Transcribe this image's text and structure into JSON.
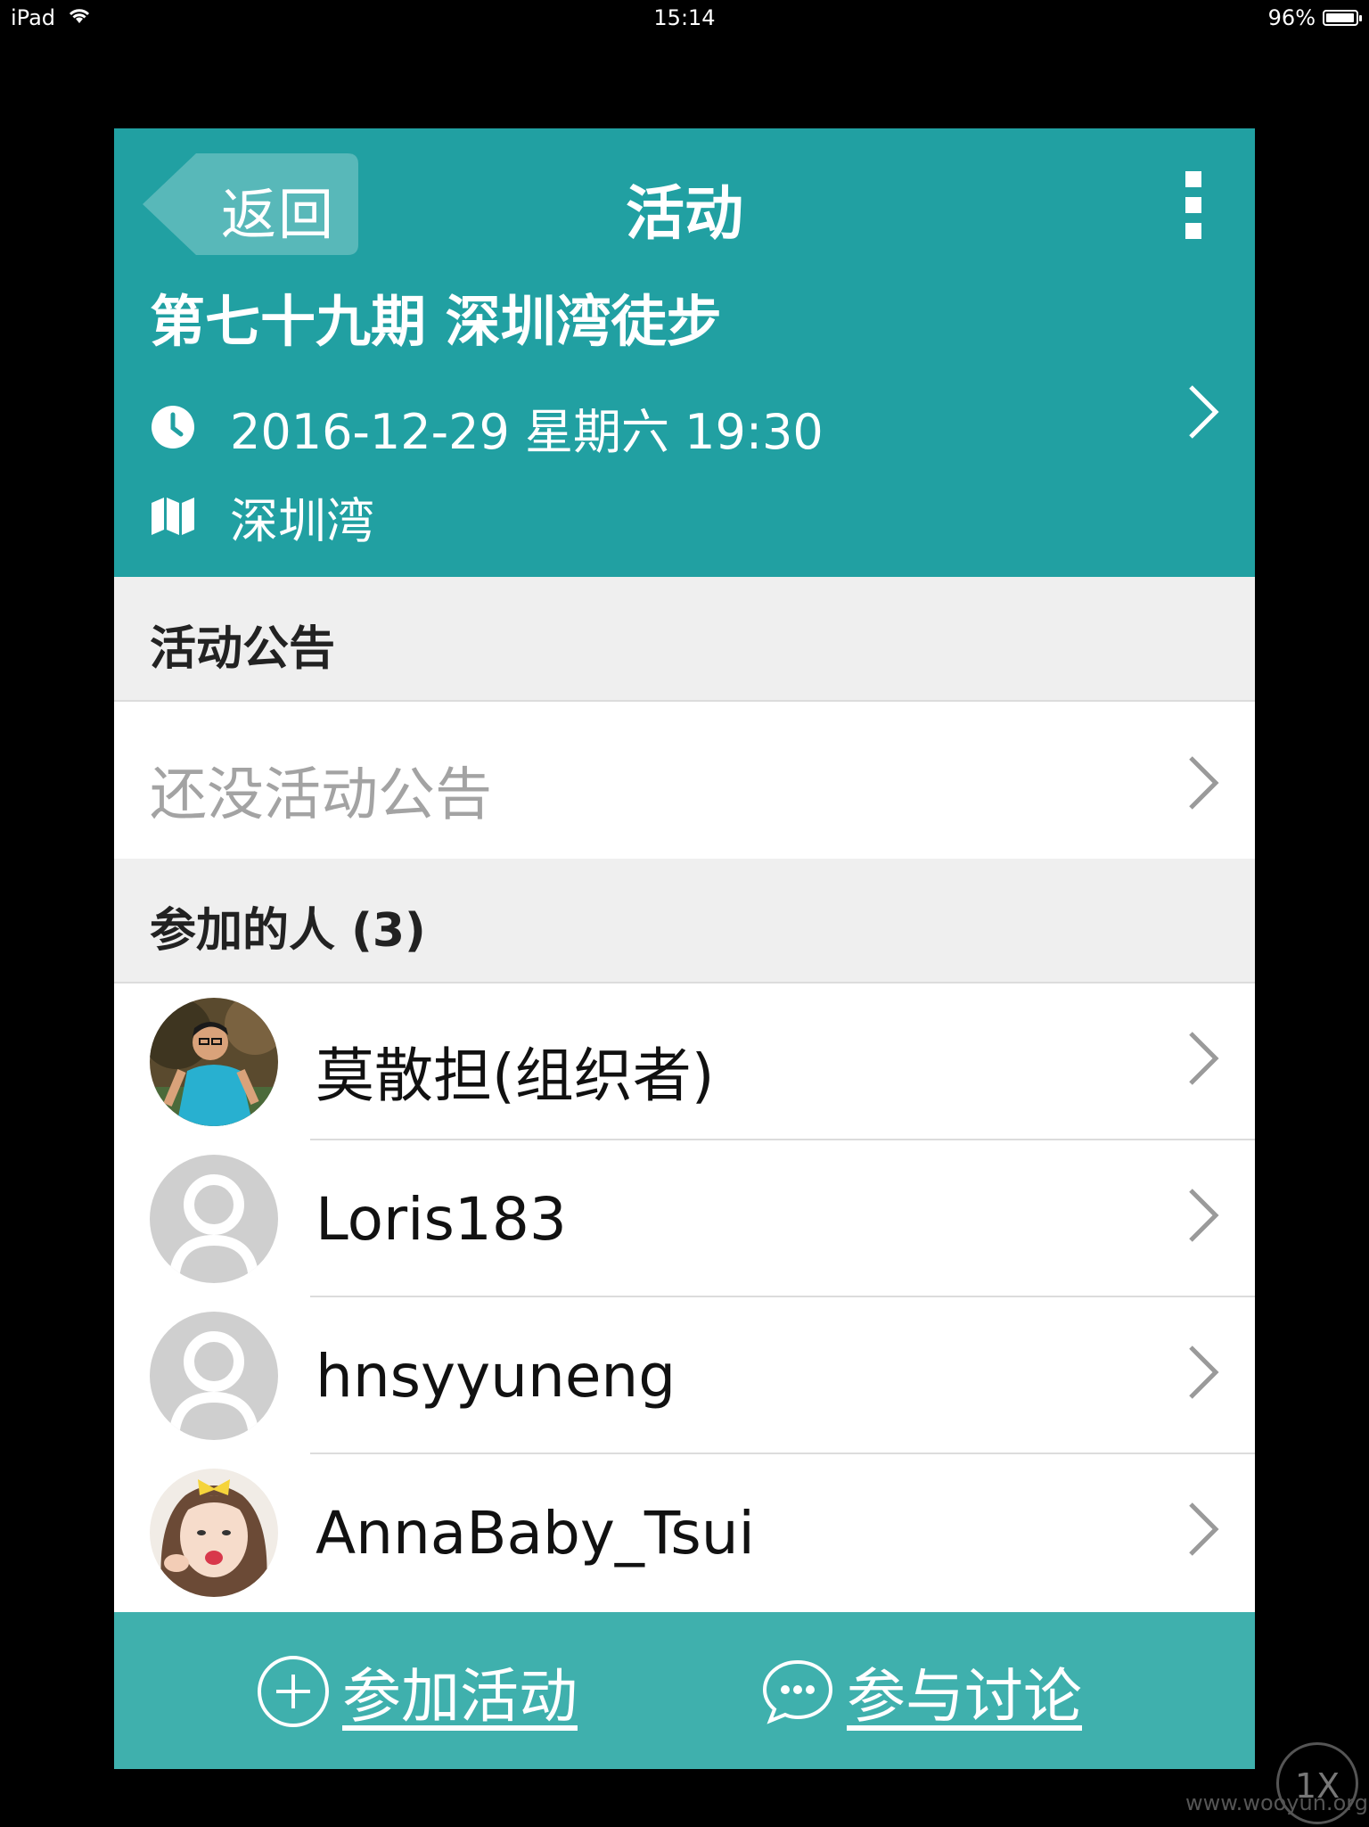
{
  "status_bar": {
    "device": "iPad",
    "time": "15:14",
    "battery": "96%",
    "battery_level": 0.96
  },
  "nav": {
    "back_label": "返回",
    "title": "活动"
  },
  "event": {
    "title": "第七十九期 深圳湾徒步",
    "datetime": "2016-12-29 星期六 19:30",
    "location": "深圳湾"
  },
  "notice_section": {
    "header": "活动公告",
    "empty_text": "还没活动公告"
  },
  "members_section": {
    "header": "参加的人 (3)",
    "members": [
      {
        "name": "莫散担(组织者)",
        "avatar": "photo-man-outdoor"
      },
      {
        "name": "Loris183",
        "avatar": "default-avatar"
      },
      {
        "name": "hnsyyuneng",
        "avatar": "default-avatar"
      },
      {
        "name": "AnnaBaby_Tsui",
        "avatar": "photo-girl"
      }
    ]
  },
  "bottom_bar": {
    "join_label": "参加活动",
    "discuss_label": "参与讨论"
  },
  "watermark": {
    "badge": "1X",
    "url": "www.wooyun.org"
  },
  "colors": {
    "primary": "#21a0a2",
    "bottom_bar": "#3fb0ad",
    "section_bg": "#efefef",
    "placeholder_text": "#a3a3a3"
  }
}
